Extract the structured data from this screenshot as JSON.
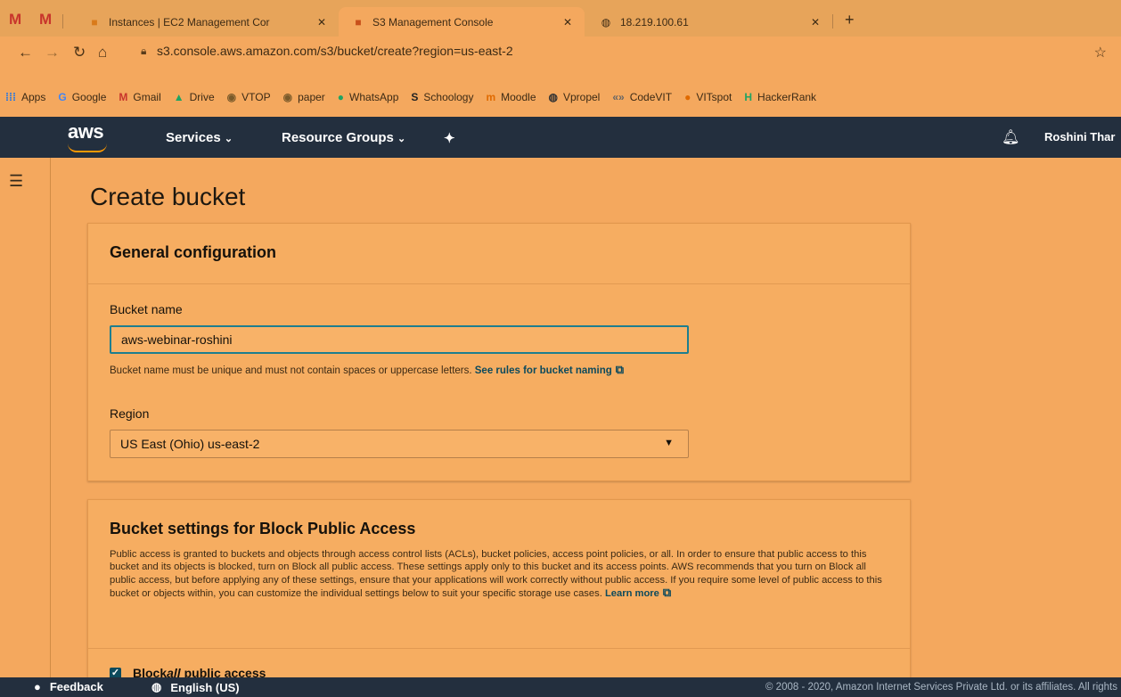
{
  "browser": {
    "tabs": [
      {
        "label": "Instances | EC2 Management Cor",
        "active": false
      },
      {
        "label": "S3 Management Console",
        "active": true
      },
      {
        "label": "18.219.100.61",
        "active": false
      }
    ],
    "new_tab": "+",
    "close_glyph": "✕",
    "url": "s3.console.aws.amazon.com/s3/bucket/create?region=us-east-2",
    "bookmarks": [
      {
        "label": "Apps",
        "icon": "apps-grid-icon",
        "glyph": "⁞⁞⁞",
        "color": "#1a73e8"
      },
      {
        "label": "Google",
        "icon": "google-icon",
        "glyph": "G",
        "color": "#4285f4"
      },
      {
        "label": "Gmail",
        "icon": "gmail-icon",
        "glyph": "M",
        "color": "#c8352c"
      },
      {
        "label": "Drive",
        "icon": "drive-icon",
        "glyph": "▲",
        "color": "#1fa463"
      },
      {
        "label": "VTOP",
        "icon": "vtop-icon",
        "glyph": "◉",
        "color": "#7a5a2a"
      },
      {
        "label": "paper",
        "icon": "paper-icon",
        "glyph": "◉",
        "color": "#7a5a2a"
      },
      {
        "label": "WhatsApp",
        "icon": "whatsapp-icon",
        "glyph": "●",
        "color": "#1fa463"
      },
      {
        "label": "Schoology",
        "icon": "schoology-icon",
        "glyph": "S",
        "color": "#222222"
      },
      {
        "label": "Moodle",
        "icon": "moodle-icon",
        "glyph": "m",
        "color": "#e06a00"
      },
      {
        "label": "Vpropel",
        "icon": "globe-icon",
        "glyph": "◍",
        "color": "#333333"
      },
      {
        "label": "CodeVIT",
        "icon": "codevit-icon",
        "glyph": "«»",
        "color": "#666666"
      },
      {
        "label": "VITspot",
        "icon": "vitspot-icon",
        "glyph": "●",
        "color": "#e06a00"
      },
      {
        "label": "HackerRank",
        "icon": "hackerrank-icon",
        "glyph": "H",
        "color": "#1fa463"
      }
    ]
  },
  "aws_nav": {
    "logo": "aws",
    "services": "Services",
    "resource_groups": "Resource Groups",
    "user": "Roshini Thar"
  },
  "page": {
    "title": "Create bucket",
    "general": {
      "title": "General configuration",
      "bucket_name_label": "Bucket name",
      "bucket_name_value": "aws-webinar-roshini",
      "hint_text": "Bucket name must be unique and must not contain spaces or uppercase letters. ",
      "hint_link": "See rules for bucket naming",
      "region_label": "Region",
      "region_value": "US East (Ohio) us-east-2"
    },
    "block_access": {
      "title": "Bucket settings for Block Public Access",
      "description": "Public access is granted to buckets and objects through access control lists (ACLs), bucket policies, access point policies, or all. In order to ensure that public access to this bucket and its objects is blocked, turn on Block all public access. These settings apply only to this bucket and its access points. AWS recommends that you turn on Block all public access, but before applying any of these settings, ensure that your applications will work correctly without public access. If you require some level of public access to this bucket or objects within, you can customize the individual settings below to suit your specific storage use cases. ",
      "learn_more": "Learn more",
      "block_all_pre": "Block ",
      "block_all_em": "all",
      "block_all_post": " public access",
      "checked": true
    }
  },
  "footer": {
    "feedback": "Feedback",
    "language": "English (US)",
    "copyright": "© 2008 - 2020, Amazon Internet Services Private Ltd. or its affiliates. All rights"
  },
  "colors": {
    "aws_nav_bg": "#232f3e",
    "aws_orange": "#ff9900",
    "link": "#0d4a5c",
    "focus_border": "#1d7e8f"
  }
}
